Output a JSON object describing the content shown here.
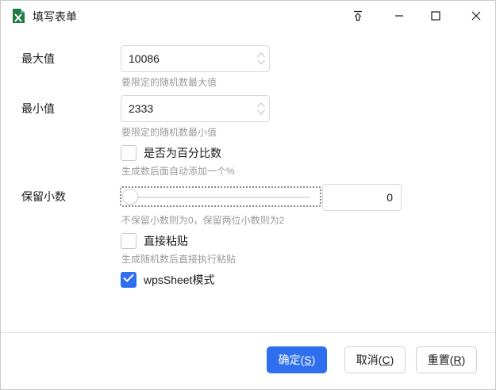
{
  "window": {
    "title": "填写表单",
    "icon": "excel-icon",
    "controls": [
      "pin-icon",
      "minimize-icon",
      "maximize-icon",
      "close-icon"
    ]
  },
  "form": {
    "max": {
      "label": "最大值",
      "value": "10086",
      "hint": "要限定的随机数最大值"
    },
    "min": {
      "label": "最小值",
      "value": "2333",
      "hint": "要限定的随机数最小值"
    },
    "percent": {
      "label": "是否为百分比数",
      "checked": false,
      "hint": "生成数后面自动添加一个%"
    },
    "decimal": {
      "label": "保留小数",
      "slider_level": 0,
      "value": "0",
      "hint": "不保留小数则为0，保留两位小数则为2"
    },
    "paste": {
      "label": "直接粘贴",
      "checked": false,
      "hint": "生成随机数后直接执行粘贴"
    },
    "wps": {
      "label": "wpsSheet模式",
      "checked": true
    }
  },
  "footer": {
    "confirm": {
      "label": "确定(",
      "key": "S",
      "suffix": ")"
    },
    "cancel": {
      "label": "取消(",
      "key": "C",
      "suffix": ")"
    },
    "reset": {
      "label": "重置(",
      "key": "R",
      "suffix": ")"
    }
  },
  "colors": {
    "accent": "#2f6fef",
    "excel_green": "#1d7a45",
    "hint": "#9a9a9a",
    "border": "#d9d9d9"
  }
}
